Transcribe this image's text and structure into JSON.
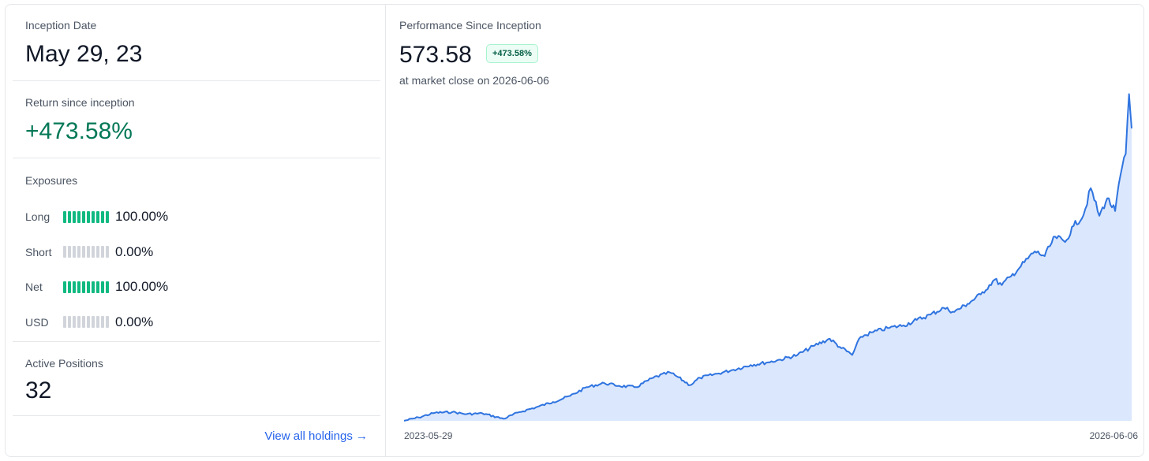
{
  "inception": {
    "label": "Inception Date",
    "value": "May 29, 23"
  },
  "return": {
    "label": "Return since inception",
    "value": "+473.58%",
    "color": "#047857"
  },
  "exposures": {
    "label": "Exposures",
    "rows": [
      {
        "label": "Long",
        "value": "100.00%",
        "fraction": 1.0
      },
      {
        "label": "Short",
        "value": "0.00%",
        "fraction": 0.0
      },
      {
        "label": "Net",
        "value": "100.00%",
        "fraction": 1.0
      },
      {
        "label": "USD",
        "value": "0.00%",
        "fraction": 0.0
      }
    ],
    "on_color": "#10b981",
    "off_color": "#d1d5db"
  },
  "positions": {
    "label": "Active Positions",
    "value": "32"
  },
  "view_all": {
    "label": "View all holdings →",
    "color": "#2563eb"
  },
  "performance": {
    "title": "Performance Since Inception",
    "value": "573.58",
    "badge": "+473.58%",
    "subtitle": "at market close on 2026-06-06"
  },
  "chart_data": {
    "type": "area",
    "x_start_label": "2023-05-29",
    "x_end_label": "2026-06-06",
    "line_color": "#2f74e0",
    "fill_color": "#dbe7fc",
    "ylim": [
      100,
      590
    ],
    "x": [
      "2023-05-29",
      "2023-06-20",
      "2023-07-15",
      "2023-08-10",
      "2023-09-01",
      "2023-09-25",
      "2023-10-27",
      "2023-11-20",
      "2023-12-15",
      "2024-01-10",
      "2024-02-05",
      "2024-03-01",
      "2024-03-28",
      "2024-04-19",
      "2024-05-15",
      "2024-06-10",
      "2024-07-05",
      "2024-07-16",
      "2024-08-05",
      "2024-08-20",
      "2024-09-15",
      "2024-10-10",
      "2024-11-05",
      "2024-12-01",
      "2024-12-20",
      "2025-01-15",
      "2025-02-10",
      "2025-03-05",
      "2025-03-20",
      "2025-04-08",
      "2025-04-21",
      "2025-05-10",
      "2025-06-01",
      "2025-06-25",
      "2025-07-15",
      "2025-08-05",
      "2025-08-25",
      "2025-09-10",
      "2025-09-30",
      "2025-10-20",
      "2025-11-10",
      "2025-11-21",
      "2025-12-05",
      "2025-12-20",
      "2026-01-10",
      "2026-01-25",
      "2026-02-10",
      "2026-02-25",
      "2026-03-10",
      "2026-03-25",
      "2026-04-05",
      "2026-04-18",
      "2026-04-30",
      "2026-05-12",
      "2026-05-20",
      "2026-05-28",
      "2026-06-02",
      "2026-06-06"
    ],
    "y": [
      100,
      105,
      112,
      113,
      110,
      111,
      103,
      113,
      120,
      128,
      137,
      150,
      156,
      152,
      150,
      164,
      172,
      166,
      153,
      164,
      170,
      176,
      183,
      187,
      191,
      198,
      212,
      222,
      210,
      198,
      225,
      232,
      238,
      242,
      250,
      258,
      268,
      262,
      274,
      288,
      310,
      302,
      315,
      330,
      352,
      345,
      374,
      366,
      390,
      406,
      446,
      405,
      431,
      412,
      465,
      497,
      586,
      535
    ]
  }
}
